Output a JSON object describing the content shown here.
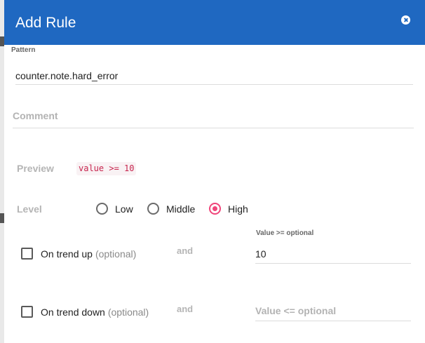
{
  "dialog": {
    "title": "Add Rule",
    "close_icon": "close-circle-icon"
  },
  "pattern": {
    "label": "Pattern",
    "value": "counter.note.hard_error"
  },
  "comment": {
    "placeholder": "Comment",
    "value": ""
  },
  "preview": {
    "label": "Preview",
    "code": "value >= 10"
  },
  "level": {
    "label": "Level",
    "options": [
      "Low",
      "Middle",
      "High"
    ],
    "selected": "High"
  },
  "trend_up": {
    "label": "On trend up",
    "optional": "(optional)",
    "checked": false,
    "connector": "and",
    "value_label": "Value >= optional",
    "value": "10"
  },
  "trend_down": {
    "label": "On trend down",
    "optional": "(optional)",
    "checked": false,
    "connector": "and",
    "placeholder": "Value <= optional",
    "value": ""
  },
  "colors": {
    "header": "#1f68c1",
    "accent": "#f0457a",
    "code": "#c7254e"
  }
}
